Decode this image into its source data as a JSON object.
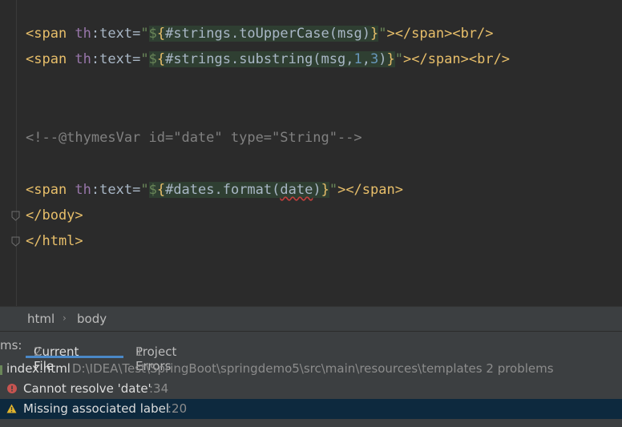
{
  "editor": {
    "line1": {
      "open": "<span ",
      "attr": "th",
      "colon": ":text=",
      "q1": "\"",
      "d": "$",
      "b": "{",
      "expr": "#strings.toUpperCase(msg)",
      "bc": "}",
      "q2": "\"",
      "close": "></span><br/>"
    },
    "line2": {
      "open": "<span ",
      "attr": "th",
      "colon": ":text=",
      "q1": "\"",
      "d": "$",
      "b": "{",
      "expr": "#strings.substring(msg,",
      "n1": "1",
      "comma": ",",
      "n2": "3",
      "paren": ")",
      "bc": "}",
      "q2": "\"",
      "close": "></span><br/>"
    },
    "comment": "<!--@thymesVar id=\"date\" type=\"String\"-->",
    "line4": {
      "open": "<span ",
      "attr": "th",
      "colon": ":text=",
      "q1": "\"",
      "d": "$",
      "b": "{",
      "expr": "#dates.format(",
      "arg": "date",
      "paren": ")",
      "bc": "}",
      "q2": "\"",
      "close": "></span>"
    },
    "line5": "</body>",
    "line6": "</html>"
  },
  "breadcrumb": [
    "html",
    "body"
  ],
  "problems": {
    "label": "ms:",
    "tabs": [
      {
        "label": "Current File",
        "count": "2"
      },
      {
        "label": "Project Errors",
        "count": "1"
      }
    ],
    "file": {
      "name": "index.html",
      "path": "D:\\IDEA\\Test\\SpringBoot\\springdemo5\\src\\main\\resources\\templates",
      "summary": "2 problems"
    },
    "items": [
      {
        "text": "Cannot resolve 'date'",
        "loc": ":34"
      },
      {
        "text": "Missing associated label",
        "loc": ":20"
      }
    ]
  }
}
